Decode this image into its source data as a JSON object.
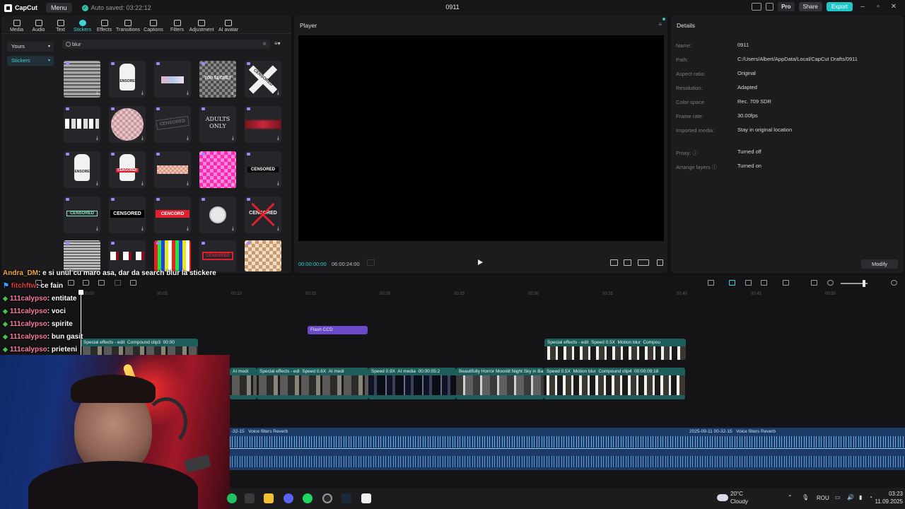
{
  "titlebar": {
    "app_name": "CapCut",
    "menu_label": "Menu",
    "autosave_text": "Auto saved: 03:22:12",
    "project_name": "0911",
    "pro_label": "Pro",
    "share_label": "Share",
    "export_label": "Export"
  },
  "tools": [
    {
      "label": "Media"
    },
    {
      "label": "Audio"
    },
    {
      "label": "Text"
    },
    {
      "label": "Stickers"
    },
    {
      "label": "Effects"
    },
    {
      "label": "Transitions"
    },
    {
      "label": "Captions"
    },
    {
      "label": "Filters"
    },
    {
      "label": "Adjustment"
    },
    {
      "label": "AI avatar"
    }
  ],
  "sidebar": {
    "items": [
      {
        "label": "Yours"
      },
      {
        "label": "Stickers"
      }
    ]
  },
  "search": {
    "value": "blur"
  },
  "stickers": {
    "top_secret": "TOP SECRET",
    "censored": "CENSORED",
    "adults_only": "ADULTS\nONLY",
    "cencored": "CENCORD",
    "censored_alt": "CENSORED"
  },
  "player": {
    "title": "Player",
    "time_current": "00:00:00:00",
    "time_total": "06:00:24:00"
  },
  "details": {
    "title": "Details",
    "rows": [
      {
        "label": "Name:",
        "value": "0911"
      },
      {
        "label": "Path:",
        "value": "C:/Users/Albert/AppData/Local/CapCut Drafts/0911"
      },
      {
        "label": "Aspect ratio:",
        "value": "Original"
      },
      {
        "label": "Resolution:",
        "value": "Adapted"
      },
      {
        "label": "Color space",
        "value": "Rec. 709 SDR"
      },
      {
        "label": "Frame rate:",
        "value": "30.00fps"
      },
      {
        "label": "Imported media:",
        "value": "Stay in original location"
      },
      {
        "label": "Proxy:",
        "value": "Turned off"
      },
      {
        "label": "Arrange layers",
        "value": "Turned on"
      }
    ],
    "modify_label": "Modify"
  },
  "timeline": {
    "ruler": [
      "00:00",
      "00:05",
      "00:10",
      "00:15",
      "00:20",
      "00:25",
      "00:30",
      "00:35",
      "00:40",
      "00:45",
      "00:50"
    ],
    "clips": {
      "flash": "Flash CCD",
      "c1": "Special effects - edit",
      "c1b": "Compound clip3",
      "c1c": "00:00",
      "c2": "Special effects - edit",
      "c2b": "Speed 0.5X",
      "c2c": "Motion blur",
      "c2d": "Compou",
      "m1": "AI medi",
      "m2": "Special effects - edi",
      "m3": "Speed 0.6X",
      "m4": "AI medi",
      "m5": "Speed 0.9X",
      "m6": "AI media",
      "m6b": "00:00:05:2",
      "m7": "Beautifully Horror Moonlit Night Sky in Ba",
      "m8": "Speed 0.5X",
      "m8b": "Motion blur",
      "m8c": "Compound clip4",
      "m8d": "00:00:09:18"
    },
    "audio": {
      "a1": "-32-15",
      "a1b": "Voice filters Reverb",
      "a2": "2025-09-11 00-32-15",
      "a2b": "Voice filters Reverb"
    }
  },
  "chat": [
    {
      "user": "Andra_DM",
      "text": ": e si unul cu maro asa, dar da search blur la stickere"
    },
    {
      "user": "fitchftw",
      "text": ": ce fain"
    },
    {
      "user": "111calypso",
      "text": ": entitate"
    },
    {
      "user": "111calypso",
      "text": ": voci"
    },
    {
      "user": "111calypso",
      "text": ": spirite"
    },
    {
      "user": "111calypso",
      "text": ": bun gasit"
    },
    {
      "user": "111calypso",
      "text": ": prieteni"
    }
  ],
  "taskbar": {
    "temperature": "20°C",
    "weather": "Cloudy",
    "language": "ROU",
    "time": "03:23",
    "date": "11.09.2025"
  }
}
